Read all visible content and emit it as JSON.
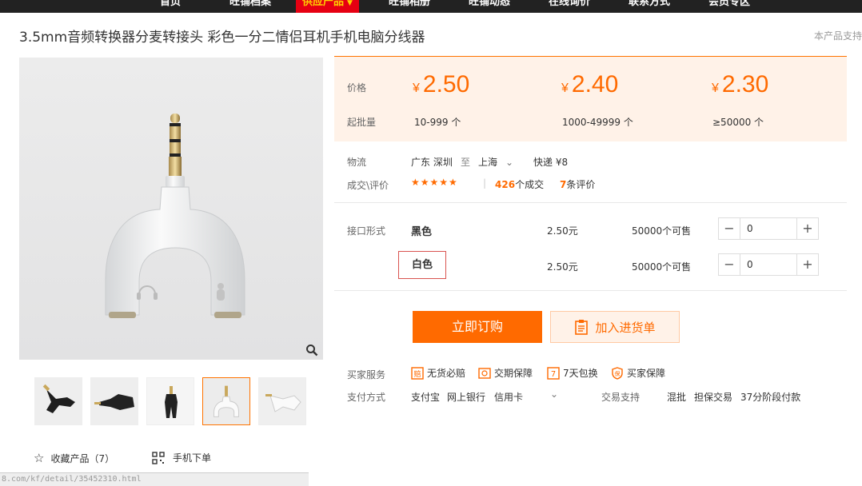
{
  "nav": {
    "items": [
      {
        "label": "首页"
      },
      {
        "label": "旺铺档案"
      },
      {
        "label": "供应产品"
      },
      {
        "label": "旺铺相册"
      },
      {
        "label": "旺铺动态"
      },
      {
        "label": "在线询价"
      },
      {
        "label": "联系方式"
      },
      {
        "label": "会员专区"
      }
    ]
  },
  "product": {
    "title": "3.5mm音频转换器分麦转接头 彩色一分二情侣耳机手机电脑分线器",
    "support_note": "本产品支持"
  },
  "pricing": {
    "price_label": "价格",
    "qty_label": "起批量",
    "currency": "¥",
    "tiers": [
      {
        "price": "2.50",
        "range": "10-999 个"
      },
      {
        "price": "2.40",
        "range": "1000-49999 个"
      },
      {
        "price": "2.30",
        "range": "≥50000 个"
      }
    ]
  },
  "logistics": {
    "label": "物流",
    "origin": "广东 深圳",
    "to": "至",
    "destination": "上海",
    "shipping": "快递 ¥8"
  },
  "rating": {
    "label": "成交\\评价",
    "stars": "★★★★★",
    "deals_count": "426",
    "deals_suffix": "个成交",
    "reviews_count": "7",
    "reviews_suffix": "条评价"
  },
  "sku": {
    "label": "接口形式",
    "options": [
      {
        "name": "黑色",
        "price": "2.50元",
        "stock": "50000个可售",
        "qty": "0"
      },
      {
        "name": "白色",
        "price": "2.50元",
        "stock": "50000个可售",
        "qty": "0"
      }
    ]
  },
  "actions": {
    "buy": "立即订购",
    "add_to_cart": "加入进货单"
  },
  "services": {
    "label": "买家服务",
    "items": [
      "无货必赔",
      "交期保障",
      "7天包换",
      "买家保障"
    ]
  },
  "payment": {
    "label": "支付方式",
    "methods": [
      "支付宝",
      "网上银行",
      "信用卡"
    ],
    "trade_label": "交易支持",
    "trade_methods": [
      "混批",
      "担保交易",
      "37分阶段付款"
    ]
  },
  "gallery": {
    "favorite": "收藏产品（7）",
    "mobile_order": "手机下单"
  },
  "statusbar": {
    "url": "8.com/kf/detail/35452310.html"
  },
  "colors": {
    "accent": "#ff6a00",
    "nav_bg": "#222222",
    "nav_active": "#e60012",
    "price_bg": "#fff2e8"
  }
}
